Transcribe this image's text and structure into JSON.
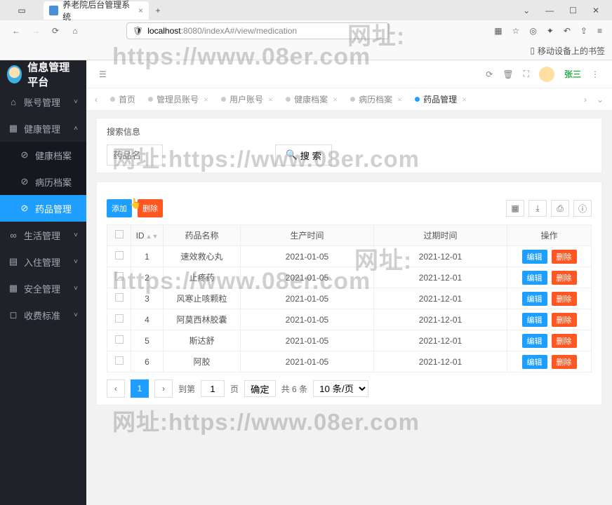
{
  "browser": {
    "tab_title": "养老院后台管理系统",
    "url_host": "localhost",
    "url_rest": ":8080/indexA#/view/medication",
    "bookmark_mobile": "移动设备上的书签"
  },
  "app": {
    "title": "信息管理平台",
    "sidebar": [
      {
        "label": "账号管理",
        "icon": "home",
        "expandable": true,
        "open": false
      },
      {
        "label": "健康管理",
        "icon": "grid",
        "expandable": true,
        "open": true,
        "children": [
          {
            "label": "健康档案",
            "icon": "dash"
          },
          {
            "label": "病历档案",
            "icon": "dash"
          },
          {
            "label": "药品管理",
            "icon": "dash",
            "active": true
          }
        ]
      },
      {
        "label": "生活管理",
        "icon": "link",
        "expandable": true,
        "open": false
      },
      {
        "label": "入住管理",
        "icon": "doc",
        "expandable": true,
        "open": false
      },
      {
        "label": "安全管理",
        "icon": "calendar",
        "expandable": true,
        "open": false
      },
      {
        "label": "收费标准",
        "icon": "tag",
        "expandable": true,
        "open": false
      }
    ],
    "username": "张三"
  },
  "tabs": [
    {
      "label": "首页",
      "closable": false
    },
    {
      "label": "管理员账号",
      "closable": true
    },
    {
      "label": "用户账号",
      "closable": true
    },
    {
      "label": "健康档案",
      "closable": true
    },
    {
      "label": "病历档案",
      "closable": true
    },
    {
      "label": "药品管理",
      "closable": true,
      "active": true
    }
  ],
  "search": {
    "title": "搜索信息",
    "placeholder": "药品名",
    "button": "搜 索"
  },
  "actions": {
    "add": "添加",
    "delete": "删除"
  },
  "table": {
    "columns": {
      "id": "ID",
      "name": "药品名称",
      "prod": "生产时间",
      "exp": "过期时间",
      "op": "操作"
    },
    "op_edit": "编辑",
    "op_delete": "删除",
    "rows": [
      {
        "id": 1,
        "name": "速效救心丸",
        "prod": "2021-01-05",
        "exp": "2021-12-01"
      },
      {
        "id": 2,
        "name": "止疼药",
        "prod": "2021-01-05",
        "exp": "2021-12-01"
      },
      {
        "id": 3,
        "name": "风寒止咳颗粒",
        "prod": "2021-01-05",
        "exp": "2021-12-01"
      },
      {
        "id": 4,
        "name": "阿莫西林胶囊",
        "prod": "2021-01-05",
        "exp": "2021-12-01"
      },
      {
        "id": 5,
        "name": "斯达舒",
        "prod": "2021-01-05",
        "exp": "2021-12-01"
      },
      {
        "id": 6,
        "name": "阿胶",
        "prod": "2021-01-05",
        "exp": "2021-12-01"
      }
    ]
  },
  "pagination": {
    "current": 1,
    "goto_label": "到第",
    "page_unit": "页",
    "confirm": "确定",
    "total_prefix": "共",
    "total_count": 6,
    "total_suffix": "条",
    "per_page": "10 条/页"
  },
  "watermarks": {
    "label": "网址:",
    "url": "https://www.08er.com"
  }
}
